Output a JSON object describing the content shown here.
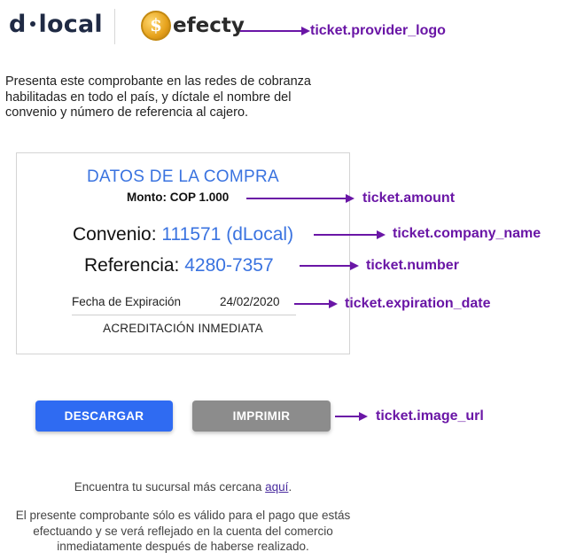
{
  "header": {
    "dlocal_left": "d",
    "dlocal_right": "local",
    "efecty_coin_symbol": "$",
    "efecty_wordmark": "efecty"
  },
  "intro_text": "Presenta este comprobante en las redes de cobranza habilitadas en todo el país, y díctale el nombre del convenio y número de referencia al cajero.",
  "ticket": {
    "title": "DATOS DE LA COMPRA",
    "amount_label": "Monto:",
    "amount_value": "COP 1.000",
    "convenio_label": "Convenio:",
    "convenio_value": "111571 (dLocal)",
    "referencia_label": "Referencia:",
    "referencia_value": "4280-7357",
    "expiration_label": "Fecha de Expiración",
    "expiration_date": "24/02/2020",
    "accreditation": "ACREDITACIÓN INMEDIATA"
  },
  "buttons": {
    "download": "DESCARGAR",
    "print": "IMPRIMIR"
  },
  "footer": {
    "branch_text": "Encuentra tu sucursal más cercana",
    "branch_link": "aquí",
    "branch_suffix": ".",
    "disclaimer": "El presente comprobante sólo es válido para el pago que estás efectuando y se verá reflejado en la cuenta del comercio inmediatamente después de haberse realizado."
  },
  "annotations": {
    "provider_logo": "ticket.provider_logo",
    "amount": "ticket.amount",
    "company_name": "ticket.company_name",
    "number": "ticket.number",
    "expiration_date": "ticket.expiration_date",
    "image_url": "ticket.image_url"
  },
  "colors": {
    "accent_blue": "#3a73e0",
    "button_blue": "#2f6bf2",
    "button_gray": "#8c8c8c",
    "annotation_purple": "#6a16a6"
  }
}
